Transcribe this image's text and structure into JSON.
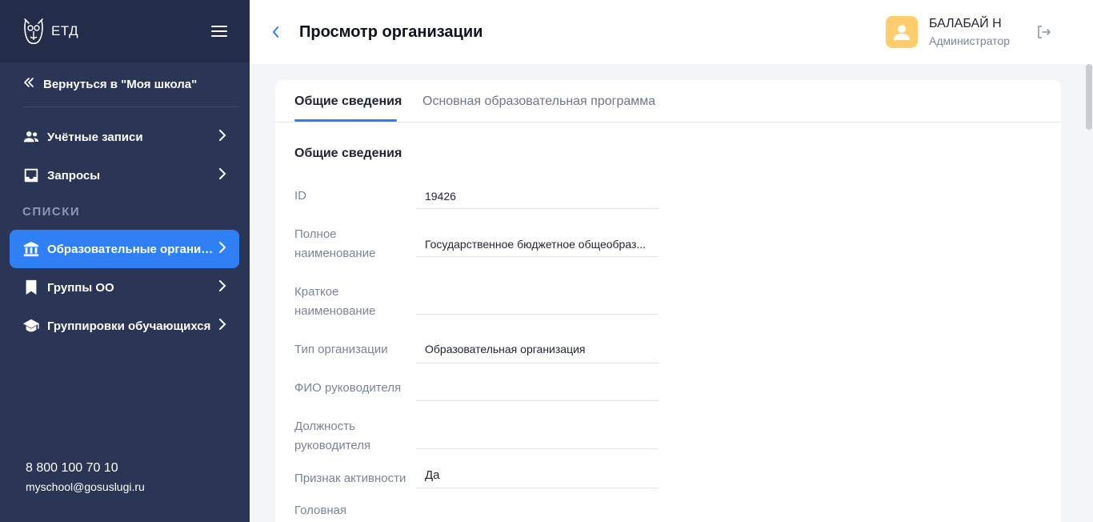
{
  "sidebar": {
    "logo_text": "ЕТД",
    "back_label": "Вернуться в \"Моя школа\"",
    "items": [
      {
        "label": "Учётные записи"
      },
      {
        "label": "Запросы"
      },
      {
        "label": "Образовательные организа..."
      },
      {
        "label": "Группы ОО"
      },
      {
        "label": "Группировки обучающихся"
      }
    ],
    "section_label": "СПИСКИ",
    "phone": "8 800 100 70 10",
    "email": "myschool@gosuslugi.ru"
  },
  "header": {
    "title": "Просмотр организации",
    "user_name": "БАЛАБАЙ Н",
    "user_role": "Администратор"
  },
  "tabs": [
    {
      "label": "Общие сведения",
      "active": true
    },
    {
      "label": "Основная образовательная программа",
      "active": false
    }
  ],
  "section_title": "Общие сведения",
  "fields": [
    {
      "label": "ID",
      "value": "19426"
    },
    {
      "label": "Полное наименование",
      "value": "Государственное бюджетное общеобраз..."
    },
    {
      "label": "Краткое наименование",
      "value": ""
    },
    {
      "label": "Тип организации",
      "value": "Образовательная организация"
    },
    {
      "label": "ФИО руководителя",
      "value": ""
    },
    {
      "label": "Должность руководителя",
      "value": ""
    },
    {
      "label": "Признак активности",
      "value": "Да"
    },
    {
      "label": "Головная",
      "value": ""
    }
  ],
  "colors": {
    "sidebar_bg": "#2b3656",
    "accent": "#2f7ff5",
    "avatar": "#ffcd6e"
  }
}
